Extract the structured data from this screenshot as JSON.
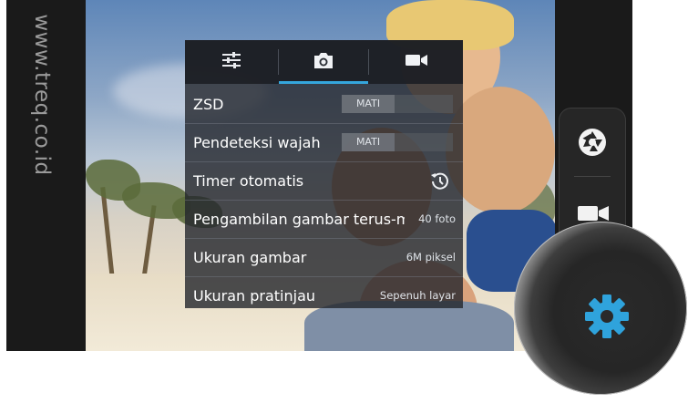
{
  "watermark": {
    "text": "www.treq.co.id"
  },
  "camera": {
    "settings_panel": {
      "tabs": [
        {
          "name": "sliders-icon",
          "active": false
        },
        {
          "name": "camera-icon",
          "active": true
        },
        {
          "name": "video-camera-icon",
          "active": false
        }
      ],
      "rows": [
        {
          "label": "ZSD",
          "toggle": "MATI"
        },
        {
          "label": "Pendeteksi wajah",
          "toggle": "MATI"
        },
        {
          "label": "Timer otomatis",
          "icon": "timer-icon"
        },
        {
          "label": "Pengambilan gambar terus-menerus",
          "value": "40 foto"
        },
        {
          "label": "Ukuran gambar",
          "value": "6M piksel"
        },
        {
          "label": "Ukuran pratinjau",
          "value": "Sepenuh layar"
        }
      ]
    },
    "side_controls": [
      {
        "name": "shutter-icon"
      },
      {
        "name": "video-record-icon"
      }
    ],
    "magnified": {
      "icon": "settings-gear-icon",
      "color": "#2fa3dc"
    }
  },
  "colors": {
    "accent": "#35a6dc",
    "gear": "#2fa3dc",
    "panel_bg": "#23262c"
  }
}
